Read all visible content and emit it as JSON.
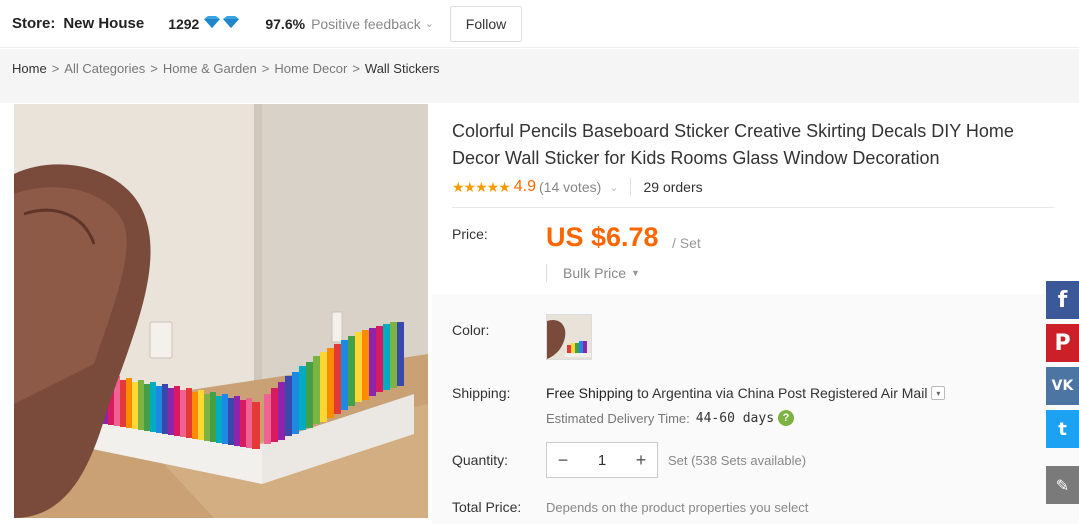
{
  "store": {
    "label": "Store:",
    "name": "New House",
    "score": "1292",
    "feedback_pct": "97.6%",
    "feedback_label": "Positive feedback",
    "follow_label": "Follow"
  },
  "breadcrumb": {
    "items": [
      "Home",
      "All Categories",
      "Home & Garden",
      "Home Decor"
    ],
    "separator": ">",
    "current": "Wall Stickers"
  },
  "product": {
    "title": "Colorful Pencils Baseboard Sticker Creative Skirting Decals DIY Home Decor Wall Sticker for Kids Rooms Glass Window Decoration",
    "stars": "★★★★★",
    "rating": "4.9",
    "votes": "(14 votes)",
    "orders": "29 orders",
    "price_label": "Price:",
    "price": "US $6.78",
    "price_unit": "/ Set",
    "bulk_label": "Bulk Price",
    "color_label": "Color:",
    "shipping_label": "Shipping:",
    "shipping_free": "Free Shipping",
    "shipping_rest": "to Argentina via China Post Registered Air Mail",
    "eta_label": "Estimated Delivery Time:",
    "eta_days": "44-60 days",
    "quantity_label": "Quantity:",
    "quantity_value": "1",
    "quantity_minus": "−",
    "quantity_plus": "+",
    "quantity_available": "Set (538 Sets available)",
    "total_label": "Total Price:",
    "total_value": "Depends on the product properties you select"
  },
  "share": {
    "facebook": "f",
    "pinterest": "P",
    "vk": "VK",
    "twitter": "t",
    "edit": "✎"
  },
  "colors": {
    "accent": "#ff6600",
    "star": "#ff9900",
    "facebook": "#3b5998",
    "pinterest": "#cb2027",
    "vk": "#4c75a3",
    "twitter": "#1da1f2"
  }
}
